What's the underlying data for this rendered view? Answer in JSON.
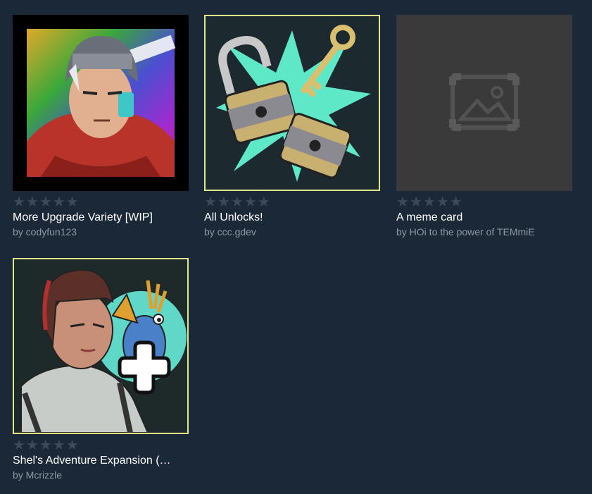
{
  "items": [
    {
      "title": "More Upgrade Variety [WIP]",
      "author": "by codyfun123",
      "rating_stars": 0,
      "image": "hero-portrait-image"
    },
    {
      "title": "All Unlocks!",
      "author": "by ccc.gdev",
      "rating_stars": 0,
      "image": "padlocks-and-key-image",
      "selected": true
    },
    {
      "title": "A meme card",
      "author": "by HOi to the power of TEMmiE",
      "rating_stars": 0,
      "image": "image-placeholder-icon"
    },
    {
      "title": "Shel's Adventure Expansion (…",
      "author": "by Mcrizzle",
      "rating_stars": 0,
      "image": "shel-and-bird-image",
      "selected": true
    }
  ],
  "star_glyph": "★",
  "colors": {
    "background": "#1b2838",
    "selected_border": "#dfe98a",
    "star_empty": "#3d4a59",
    "author_text": "#8f98a0"
  }
}
